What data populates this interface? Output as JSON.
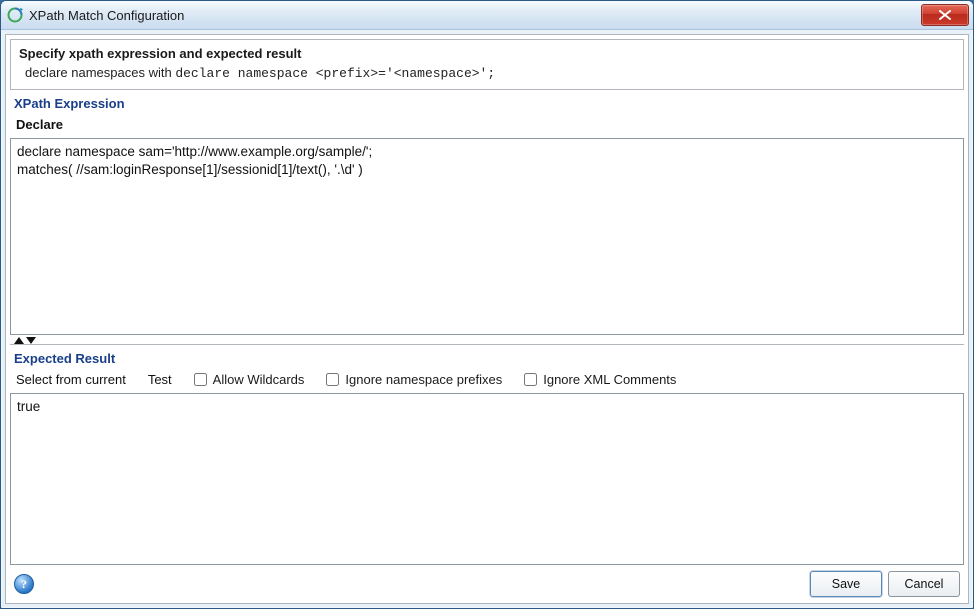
{
  "window": {
    "title": "XPath Match Configuration"
  },
  "intro": {
    "title": "Specify xpath expression and expected result",
    "desc_prefix": "declare namespaces with ",
    "desc_code": "declare namespace <prefix>='<namespace>';"
  },
  "xpath_section": {
    "header": "XPath Expression",
    "declare_label": "Declare",
    "content": "declare namespace sam='http://www.example.org/sample/';\nmatches( //sam:loginResponse[1]/sessionid[1]/text(), '.\\d' )"
  },
  "result_section": {
    "header": "Expected Result",
    "select_from_current": "Select from current",
    "test": "Test",
    "allow_wildcards": "Allow Wildcards",
    "ignore_ns": "Ignore namespace prefixes",
    "ignore_comments": "Ignore XML Comments",
    "content": "true"
  },
  "buttons": {
    "save": "Save",
    "cancel": "Cancel"
  },
  "icons": {
    "help_glyph": "?"
  }
}
